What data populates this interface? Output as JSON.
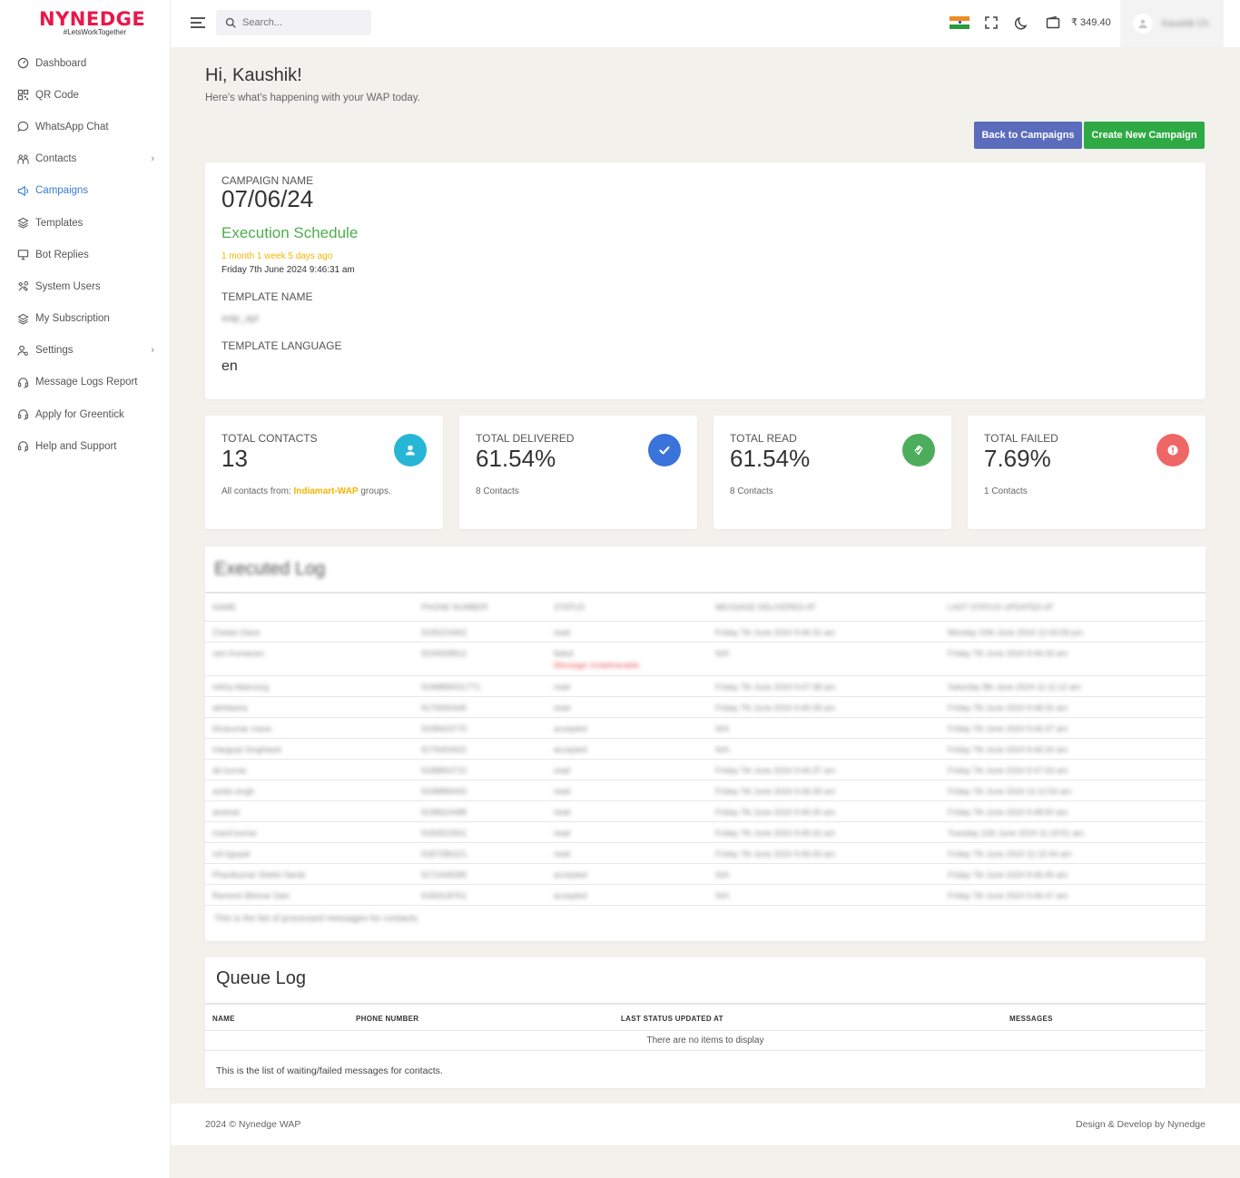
{
  "brand": {
    "name": "nynedge",
    "tagline": "#LetsWorkTogether"
  },
  "sidebar": {
    "items": [
      {
        "label": "Dashboard",
        "icon": "dashboard-icon"
      },
      {
        "label": "QR Code",
        "icon": "qr-code-icon"
      },
      {
        "label": "WhatsApp Chat",
        "icon": "chat-bubble-icon"
      },
      {
        "label": "Contacts",
        "icon": "contacts-icon",
        "has_submenu": true
      },
      {
        "label": "Campaigns",
        "icon": "megaphone-icon",
        "active": true
      },
      {
        "label": "Templates",
        "icon": "layers-icon"
      },
      {
        "label": "Bot Replies",
        "icon": "monitor-icon"
      },
      {
        "label": "System Users",
        "icon": "users-cog-icon"
      },
      {
        "label": "My Subscription",
        "icon": "layers-icon"
      },
      {
        "label": "Settings",
        "icon": "user-settings-icon",
        "has_submenu": true
      },
      {
        "label": "Message Logs Report",
        "icon": "headset-icon"
      },
      {
        "label": "Apply for Greentick",
        "icon": "headset-icon"
      },
      {
        "label": "Help and Support",
        "icon": "headset-icon"
      }
    ]
  },
  "topbar": {
    "search_placeholder": "Search...",
    "balance": "₹ 349.40",
    "user_name": "Kaushik Ch."
  },
  "header": {
    "greeting": "Hi, Kaushik!",
    "subtitle": "Here's what's happening with your WAP today.",
    "back_button": "Back to Campaigns",
    "new_button": "Create New Campaign"
  },
  "campaign": {
    "name_label": "CAMPAIGN NAME",
    "name": "07/06/24",
    "schedule_title": "Execution Schedule",
    "schedule_ago": "1 month 1 week 5 days ago",
    "schedule_date": "Friday 7th June 2024 9:46:31 am",
    "template_label": "TEMPLATE NAME",
    "template_name": "wap_api",
    "language_label": "TEMPLATE LANGUAGE",
    "language": "en"
  },
  "stats": [
    {
      "label": "TOTAL CONTACTS",
      "value": "13",
      "sub_prefix": "All contacts from: ",
      "sub_group": "Indiamart-WAP",
      "sub_suffix": " groups.",
      "color": "#27b6d6",
      "icon": "user-icon"
    },
    {
      "label": "TOTAL DELIVERED",
      "value": "61.54%",
      "sub": "8 Contacts",
      "color": "#3a73d9",
      "icon": "check-icon"
    },
    {
      "label": "TOTAL READ",
      "value": "61.54%",
      "sub": "8 Contacts",
      "color": "#4cae5c",
      "icon": "double-check-icon"
    },
    {
      "label": "TOTAL FAILED",
      "value": "7.69%",
      "sub": "1 Contacts",
      "color": "#ef6666",
      "icon": "alert-icon"
    }
  ],
  "executed_log": {
    "title": "Executed Log",
    "columns": [
      "NAME",
      "PHONE NUMBER",
      "STATUS",
      "MESSAGE DELIVERED AT",
      "LAST STATUS UPDATED AT"
    ],
    "rows": [
      [
        "Chetan Dave",
        "9195224462",
        "read",
        "Friday 7th June 2024 9:46:31 am",
        "Monday 10th June 2024 12:43:59 pm"
      ],
      [
        "ram Kumaram",
        "9194558812",
        "failed",
        "N/A",
        "Friday 7th June 2024 9:46:33 am",
        "Message Undeliverable"
      ],
      [
        "rekha Malvoorg",
        "9198889031771",
        "read",
        "Friday 7th June 2024 9:47:38 am",
        "Saturday 8th June 2024 11:11:12 am"
      ],
      [
        "abhilasha",
        "9175560445",
        "read",
        "Friday 7th June 2024 9:46:39 am",
        "Friday 7th June 2024 9:48:32 am"
      ],
      [
        "bhukumar mane",
        "9198424770",
        "accepted",
        "N/A",
        "Friday 7th June 2024 9:46:37 am"
      ],
      [
        "Hasgupt Singhtank",
        "9176454922",
        "accepted",
        "N/A",
        "Friday 7th June 2024 9:46:34 am"
      ],
      [
        "ab kumar",
        "9188854710",
        "read",
        "Friday 7th June 2024 9:46:37 am",
        "Friday 7th June 2024 9:47:33 am"
      ],
      [
        "amita singh",
        "9198889440",
        "read",
        "Friday 7th June 2024 9:46:39 am",
        "Friday 7th June 2024 11:12:54 am"
      ],
      [
        "amenar",
        "9198624488",
        "read",
        "Friday 7th June 2024 9:46:40 am",
        "Friday 7th June 2024 9:48:50 am"
      ],
      [
        "manil kumar",
        "9183522661",
        "read",
        "Friday 7th June 2024 9:46:42 am",
        "Tuesday 11th June 2024 11:19:51 am"
      ],
      [
        "mit kgupal",
        "9187286221",
        "read",
        "Friday 7th June 2024 9:46:43 am",
        "Friday 7th June 2024 11:15:44 am"
      ],
      [
        "Phanikumar Shekh Sarde",
        "9172446585",
        "accepted",
        "N/A",
        "Friday 7th June 2024 9:46:45 am"
      ],
      [
        "Ramesh Bhimar Sain",
        "9182618751",
        "accepted",
        "N/A",
        "Friday 7th June 2024 9:46:47 am"
      ]
    ],
    "footer": "This is the list of processed messages for contacts."
  },
  "queue_log": {
    "title": "Queue Log",
    "columns": [
      "NAME",
      "PHONE NUMBER",
      "LAST STATUS UPDATED AT",
      "MESSAGES"
    ],
    "empty": "There are no items to display",
    "footer": "This is the list of waiting/failed messages for contacts."
  },
  "footer": {
    "left": "2024 © Nynedge WAP",
    "right": "Design & Develop by Nynedge"
  }
}
